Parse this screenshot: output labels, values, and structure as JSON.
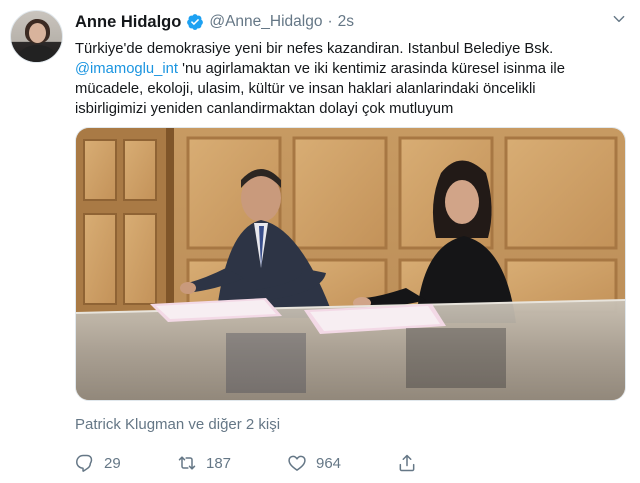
{
  "tweet": {
    "author": {
      "name": "Anne Hidalgo",
      "handle": "@Anne_Hidalgo",
      "verified": true
    },
    "separator": "·",
    "time": "2s",
    "text_lines": [
      "Türkiye'de demokrasiye yeni bir nefes kazandiran. Istanbul Belediye Bsk.",
      "'nu agirlamaktan ve iki kentimiz arasinda küresel isinma ile",
      "mücadele, ekoloji, ulasim, kültür ve insan haklari alanlarindaki öncelikli",
      "isbirligimizi yeniden canlandirmaktan dolayi çok mutluyum"
    ],
    "mention": "@imamoglu_int",
    "likers_text": "Patrick Klugman ve diğer 2 kişi",
    "counts": {
      "replies": "29",
      "retweets": "187",
      "likes": "964"
    }
  },
  "colors": {
    "accent": "#1b95e0",
    "verified": "#1da1f2",
    "muted": "#657786",
    "text": "#14171a"
  },
  "icons": {
    "avatar": "avatar-photo",
    "verified": "verified-badge-icon",
    "menu": "chevron-down-icon",
    "reply": "reply-icon",
    "retweet": "retweet-icon",
    "like": "heart-icon",
    "share": "share-icon"
  }
}
